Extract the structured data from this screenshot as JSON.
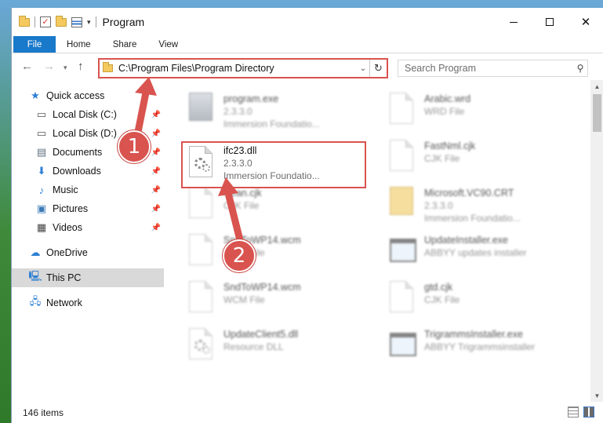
{
  "window": {
    "title": "Program"
  },
  "ribbon": {
    "tabs": [
      {
        "label": "File",
        "active": true
      },
      {
        "label": "Home"
      },
      {
        "label": "Share"
      },
      {
        "label": "View"
      }
    ]
  },
  "address": {
    "path": "C:\\Program Files\\Program Directory"
  },
  "search": {
    "placeholder": "Search Program"
  },
  "sidebar": {
    "items": [
      {
        "label": "Quick access",
        "icon": "star-icon"
      },
      {
        "label": "Local Disk (C:)",
        "icon": "drive-icon",
        "pinned": true
      },
      {
        "label": "Local Disk (D:)",
        "icon": "drive-icon",
        "pinned": true
      },
      {
        "label": "Documents",
        "icon": "documents-icon",
        "pinned": true
      },
      {
        "label": "Downloads",
        "icon": "download-icon",
        "pinned": true
      },
      {
        "label": "Music",
        "icon": "music-icon",
        "pinned": true
      },
      {
        "label": "Pictures",
        "icon": "pictures-icon",
        "pinned": true
      },
      {
        "label": "Videos",
        "icon": "videos-icon",
        "pinned": true
      },
      {
        "label": "OneDrive",
        "icon": "cloud-icon"
      },
      {
        "label": "This PC",
        "icon": "computer-icon",
        "selected": true
      },
      {
        "label": "Network",
        "icon": "network-icon"
      }
    ]
  },
  "files": {
    "highlighted": {
      "name": "ifc23.dll",
      "version": "2.3.3.0",
      "company": "Immersion Foundatio..."
    },
    "left": [
      {
        "name": "program.exe",
        "line2": "2.3.3.0",
        "line3": "Immersion Foundatio..."
      },
      {
        "name": "",
        "line2": "",
        "line3": ""
      },
      {
        "name": "clean.cjk",
        "line2": "CJK File",
        "line3": ""
      },
      {
        "name": "SndToWP14.wcm",
        "line2": "WCM File",
        "line3": ""
      },
      {
        "name": "SndToWP14.wcm",
        "line2": "WCM File",
        "line3": ""
      },
      {
        "name": "UpdateClient5.dll",
        "line2": "Resource DLL",
        "line3": ""
      }
    ],
    "right": [
      {
        "name": "Arabic.wrd",
        "line2": "WRD File",
        "line3": ""
      },
      {
        "name": "FastNml.cjk",
        "line2": "CJK File",
        "line3": ""
      },
      {
        "name": "Microsoft.VC90.CRT",
        "line2": "2.3.3.0",
        "line3": "Immersion Foundatio..."
      },
      {
        "name": "UpdateInstaller.exe",
        "line2": "ABBYY updates installer",
        "line3": ""
      },
      {
        "name": "gtd.cjk",
        "line2": "CJK File",
        "line3": ""
      },
      {
        "name": "TrigrammsInstaller.exe",
        "line2": "ABBYY Trigrammsinstaller",
        "line3": ""
      }
    ]
  },
  "status": {
    "count": "146 items"
  },
  "annotations": {
    "step1": "1",
    "step2": "2"
  },
  "colors": {
    "accent": "#1979ca",
    "annotation": "#d9534f",
    "selection": "#d9d9d9"
  }
}
